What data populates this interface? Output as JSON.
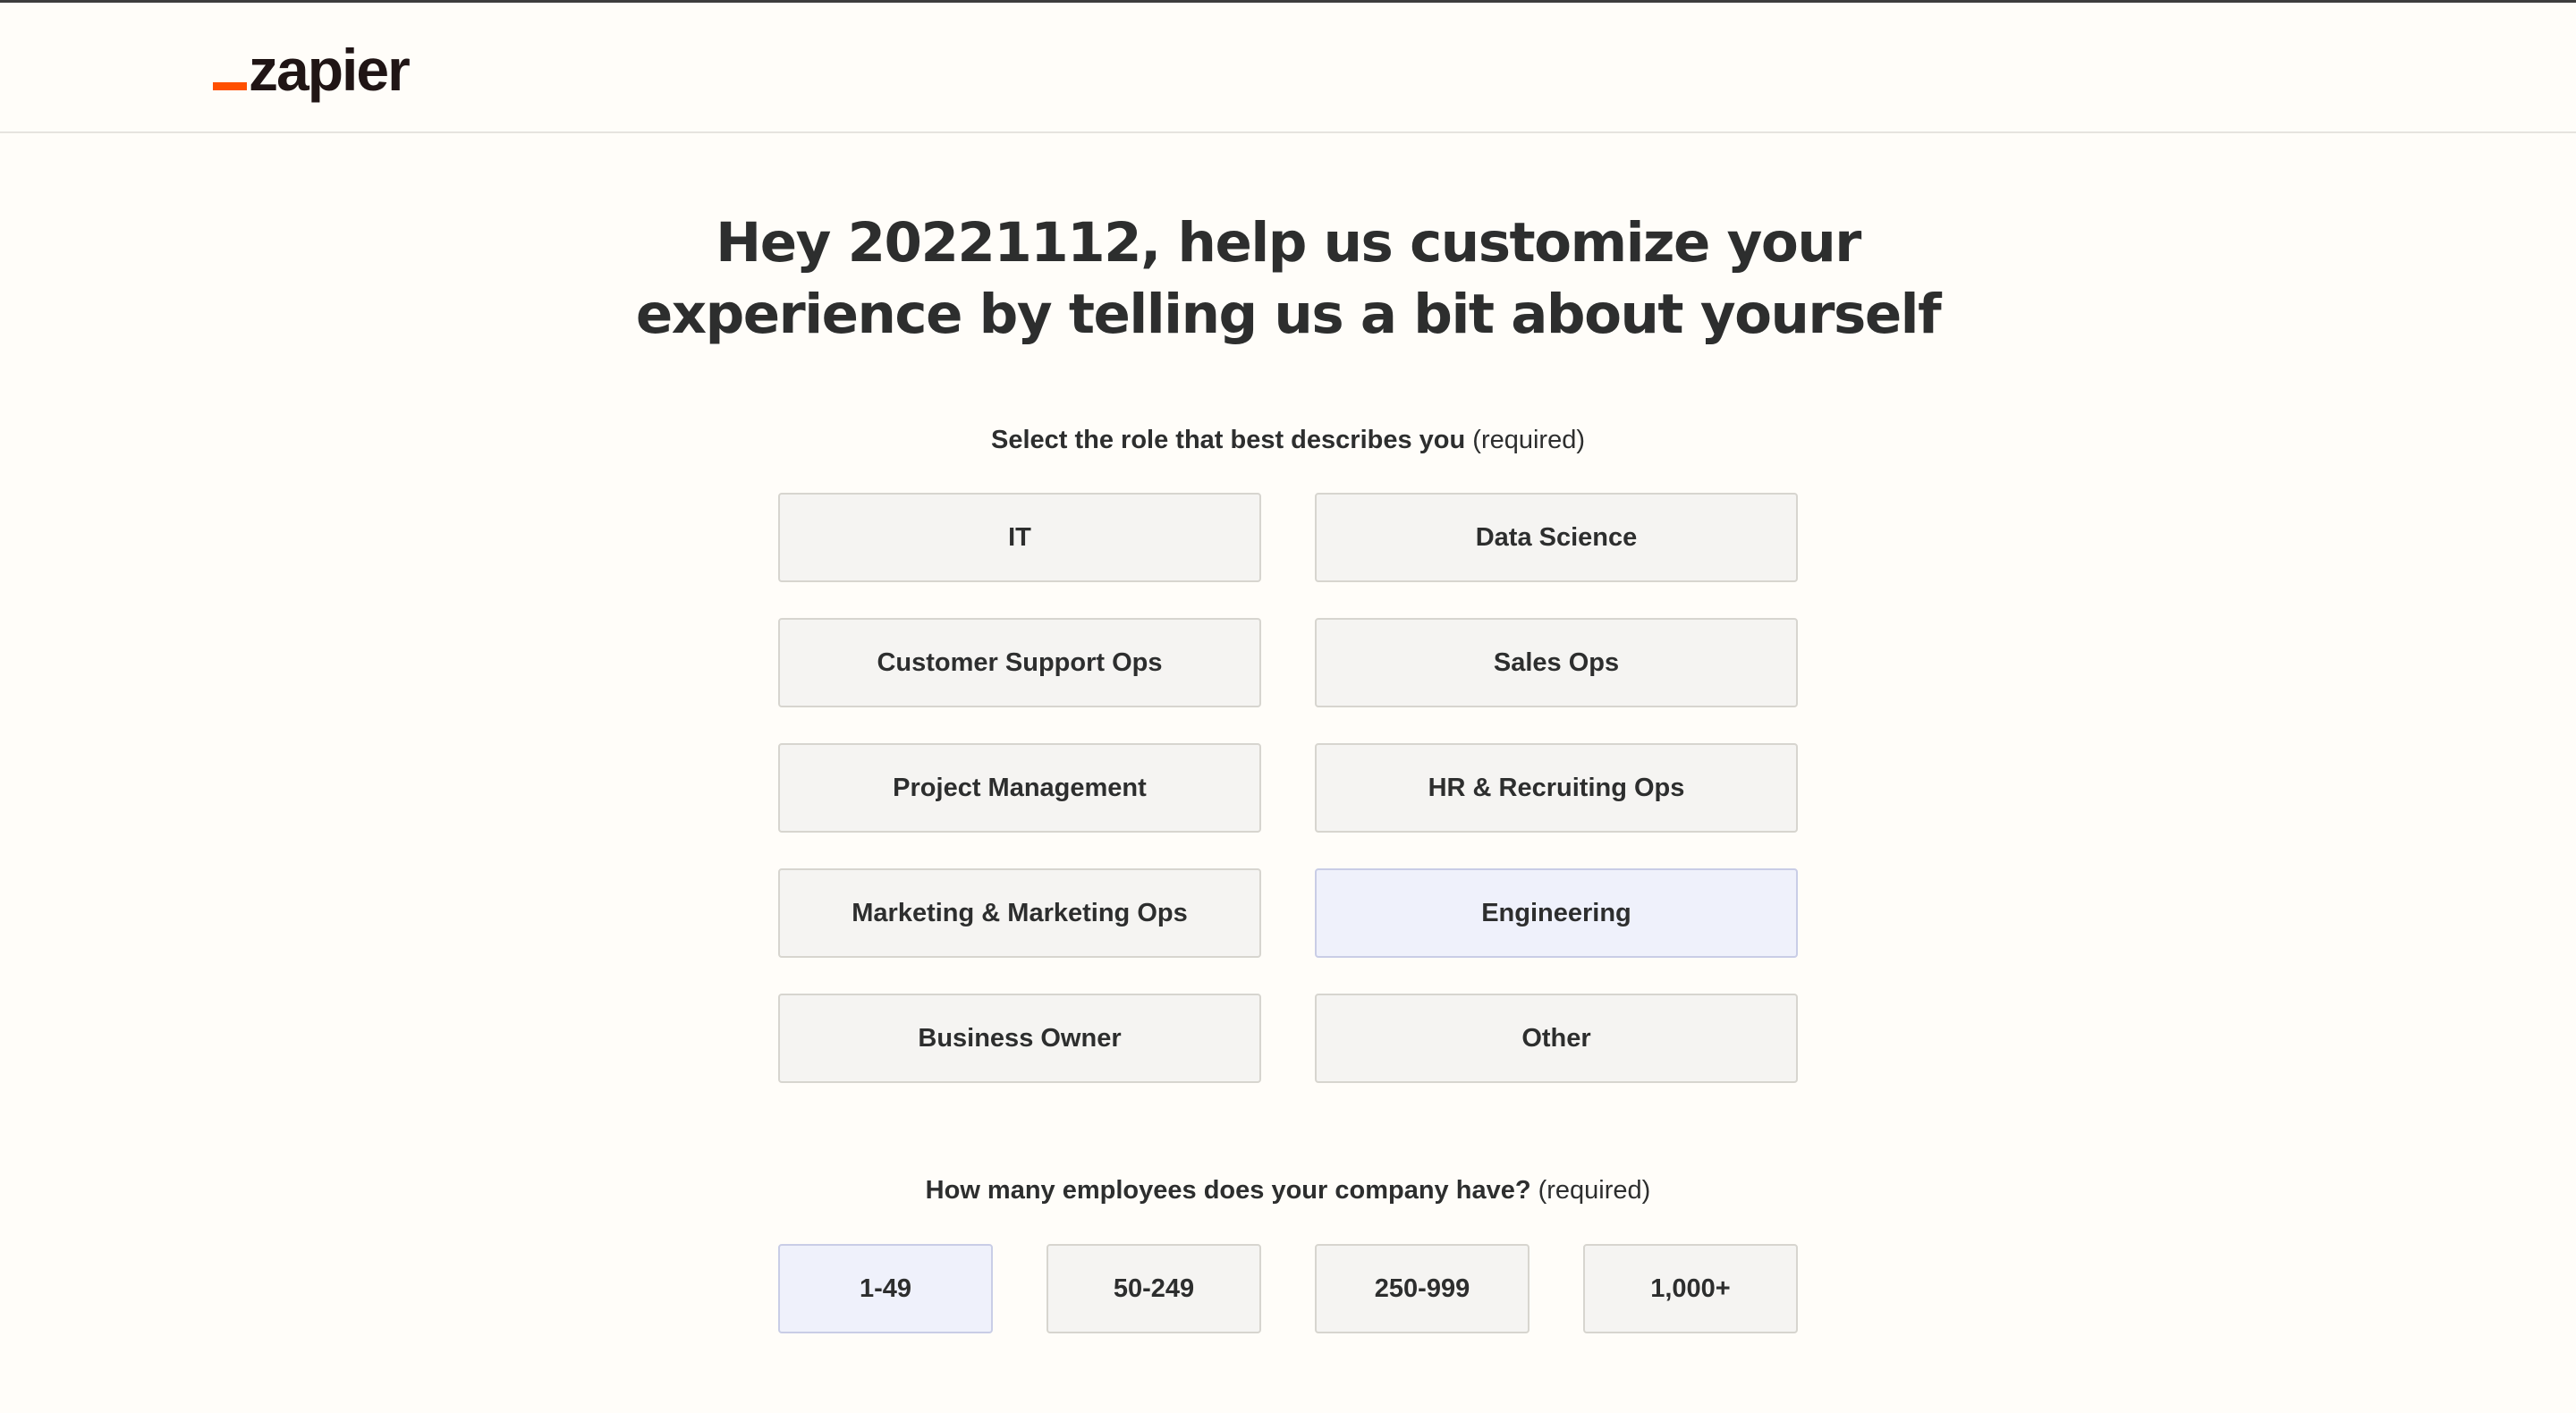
{
  "logo": {
    "text": "zapier",
    "accent_color": "#ff4f00"
  },
  "heading": "Hey 20221112, help us customize your experience by telling us a bit about yourself",
  "role_question": {
    "label": "Select the role that best describes you",
    "required": "(required)",
    "options": [
      {
        "label": "IT",
        "selected": false
      },
      {
        "label": "Data Science",
        "selected": false
      },
      {
        "label": "Customer Support Ops",
        "selected": false
      },
      {
        "label": "Sales Ops",
        "selected": false
      },
      {
        "label": "Project Management",
        "selected": false
      },
      {
        "label": "HR & Recruiting Ops",
        "selected": false
      },
      {
        "label": "Marketing & Marketing Ops",
        "selected": false
      },
      {
        "label": "Engineering",
        "selected": true
      },
      {
        "label": "Business Owner",
        "selected": false
      },
      {
        "label": "Other",
        "selected": false
      }
    ]
  },
  "employee_question": {
    "label": "How many employees does your company have?",
    "required": "(required)",
    "options": [
      {
        "label": "1-49",
        "selected": true
      },
      {
        "label": "50-249",
        "selected": false
      },
      {
        "label": "250-999",
        "selected": false
      },
      {
        "label": "1,000+",
        "selected": false
      }
    ]
  },
  "colors": {
    "background": "#fffdf9",
    "option_bg": "#f5f4f2",
    "selected_bg": "#eff1fb",
    "text": "#2d2e2e"
  }
}
